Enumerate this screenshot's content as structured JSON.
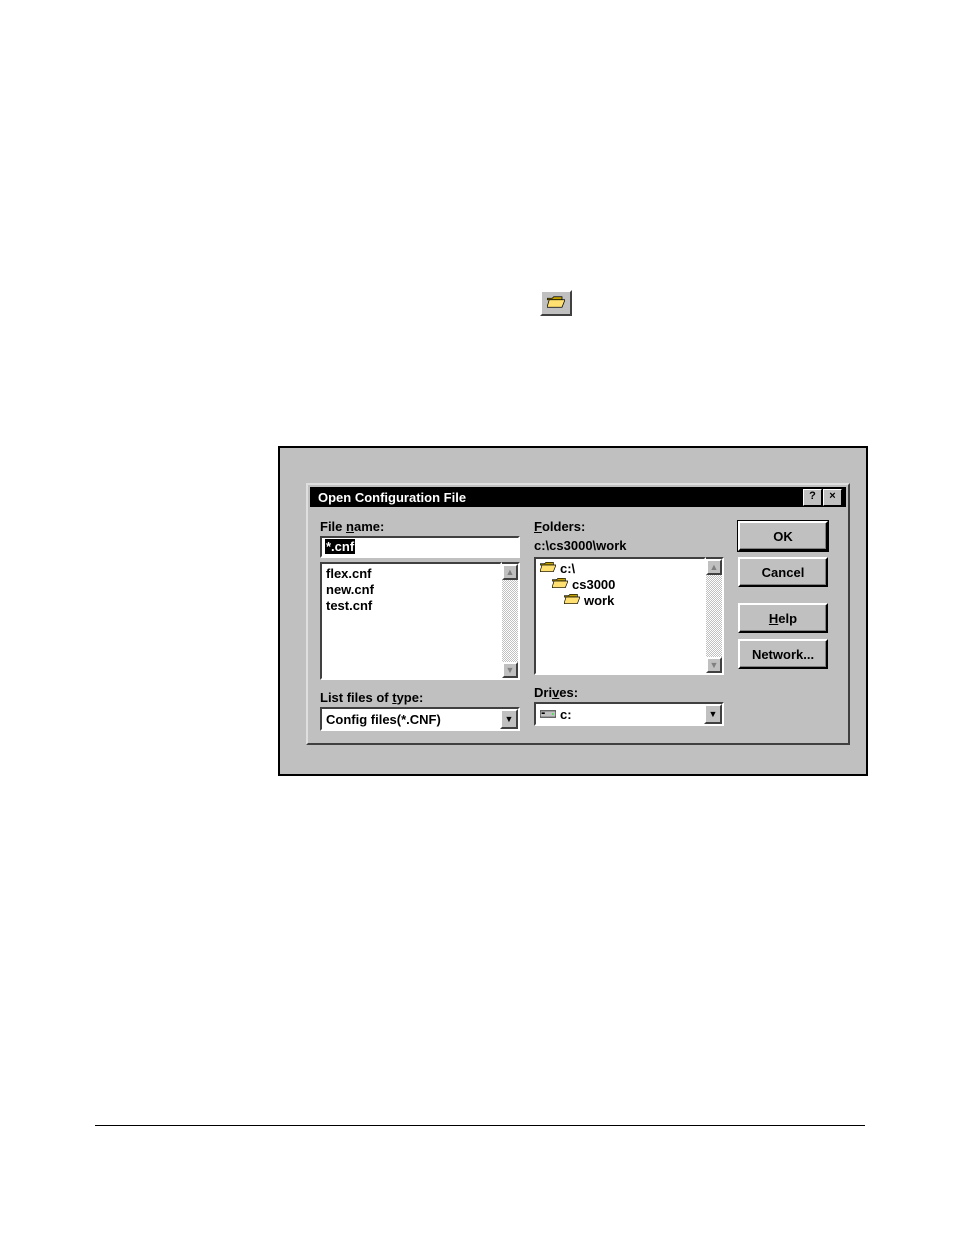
{
  "toolbar_icon": "open-folder-icon",
  "dialog": {
    "title": "Open Configuration File",
    "help_btn": "?",
    "close_btn": "×",
    "file_name_label_pre": "File ",
    "file_name_label_u": "n",
    "file_name_label_post": "ame:",
    "file_name_value": "*.cnf",
    "file_list": [
      "flex.cnf",
      "new.cnf",
      "test.cnf"
    ],
    "folders_label_u": "F",
    "folders_label_post": "olders:",
    "current_path": "c:\\cs3000\\work",
    "folder_tree": [
      {
        "label": "c:\\",
        "depth": 0
      },
      {
        "label": "cs3000",
        "depth": 1
      },
      {
        "label": "work",
        "depth": 2
      }
    ],
    "type_label_pre": "List files of ",
    "type_label_u": "t",
    "type_label_post": "ype:",
    "type_value": "Config files(*.CNF)",
    "drives_label_pre": "Dri",
    "drives_label_u": "v",
    "drives_label_post": "es:",
    "drives_value": "c:",
    "buttons": {
      "ok": "OK",
      "cancel": "Cancel",
      "help_pre": "",
      "help_u": "H",
      "help_post": "elp",
      "network": "Network..."
    }
  }
}
